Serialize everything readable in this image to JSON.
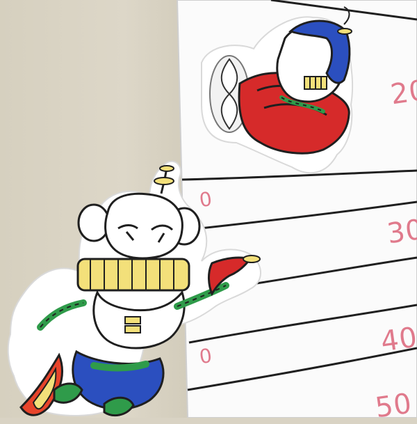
{
  "scene": {
    "description_free": true,
    "whiteboard": {
      "marks": [
        {
          "text": "20"
        },
        {
          "text": "0"
        },
        {
          "text": "30"
        },
        {
          "text": "40"
        },
        {
          "text": "0"
        },
        {
          "text": "50"
        }
      ],
      "line_color": "#1f1f1f",
      "mark_color": "#e07a8c"
    },
    "colors": {
      "wall": "#d9d3c4",
      "board": "#fbfbfb",
      "robot_yellow": "#f3e07a",
      "robot_green": "#2f9b4a",
      "plane_red": "#d62a2a",
      "pilot_blue": "#2b4fbf"
    }
  }
}
